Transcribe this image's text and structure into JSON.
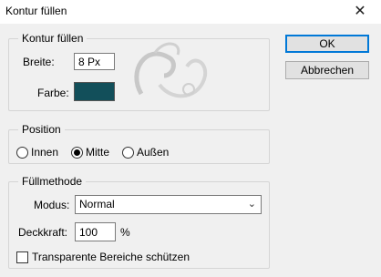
{
  "dialog": {
    "title": "Kontur füllen",
    "close_icon": "close-icon"
  },
  "stroke_group": {
    "legend": "Kontur füllen",
    "width_label": "Breite:",
    "width_value": "8 Px",
    "color_label": "Farbe:",
    "color_hex": "#124f5a"
  },
  "position_group": {
    "legend": "Position",
    "options": [
      {
        "label": "Innen",
        "selected": false
      },
      {
        "label": "Mitte",
        "selected": true
      },
      {
        "label": "Außen",
        "selected": false
      }
    ]
  },
  "blend_group": {
    "legend": "Füllmethode",
    "mode_label": "Modus:",
    "mode_value": "Normal",
    "opacity_label": "Deckkraft:",
    "opacity_value": "100",
    "opacity_unit": "%",
    "preserve_transparency_label": "Transparente Bereiche schützen",
    "preserve_transparency_checked": false
  },
  "buttons": {
    "ok_label": "OK",
    "cancel_label": "Abbrechen"
  }
}
